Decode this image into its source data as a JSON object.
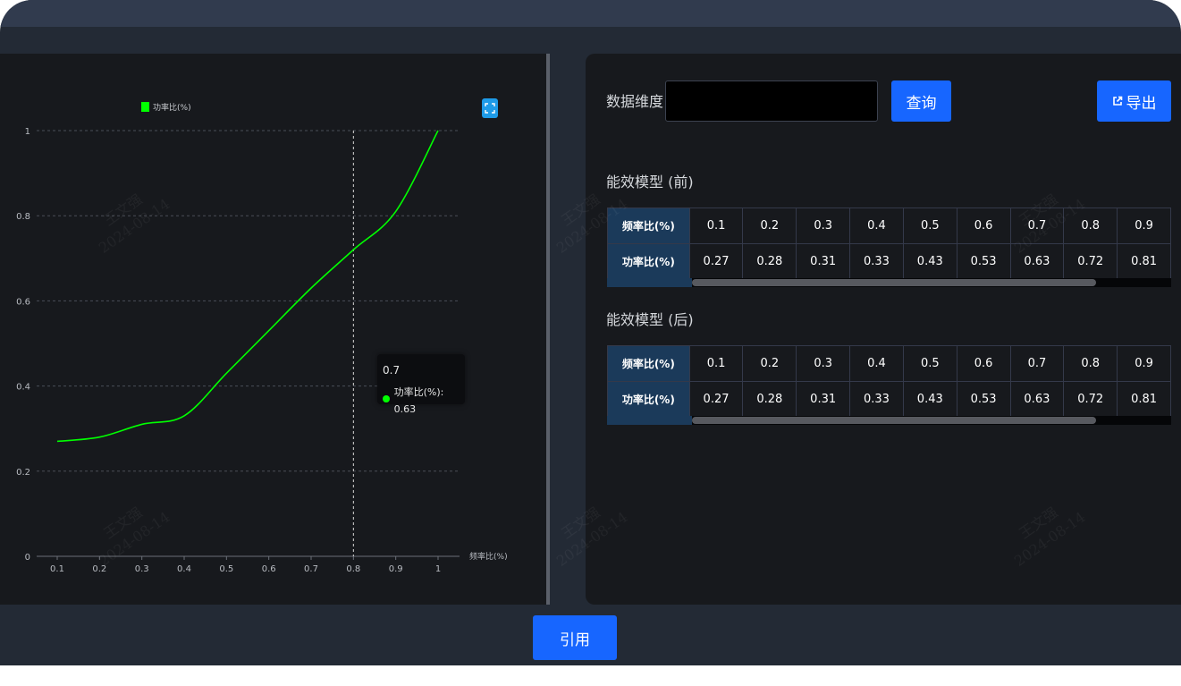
{
  "chart_data": {
    "type": "line",
    "title": "",
    "xlabel": "频率比(%)",
    "ylabel": "",
    "x": [
      0.1,
      0.2,
      0.3,
      0.4,
      0.5,
      0.6,
      0.7,
      0.8,
      0.9,
      1.0
    ],
    "xticks": [
      "0.1",
      "0.2",
      "0.3",
      "0.4",
      "0.5",
      "0.6",
      "0.7",
      "0.8",
      "0.9",
      "1"
    ],
    "yticks": [
      "0",
      "0.2",
      "0.4",
      "0.6",
      "0.8",
      "1"
    ],
    "ylim": [
      0,
      1
    ],
    "grid": true,
    "legend_position": "top-left",
    "series": [
      {
        "name": "功率比(%)",
        "color": "#00ff00",
        "values": [
          0.27,
          0.28,
          0.31,
          0.33,
          0.43,
          0.53,
          0.63,
          0.72,
          0.81,
          1.0
        ]
      }
    ],
    "tooltip": {
      "x": "0.7",
      "series": "功率比(%)",
      "value": "0.63"
    },
    "crosshair_x": 0.8
  },
  "toolbar": {
    "dimension_label": "数据维度",
    "dimension_value": "",
    "query_label": "查询",
    "export_label": "导出",
    "export_icon": "external-link-icon"
  },
  "model_before": {
    "title": "能效模型 (前)",
    "row_headers": [
      "频率比(%)",
      "功率比(%)"
    ],
    "freq": [
      "0.1",
      "0.2",
      "0.3",
      "0.4",
      "0.5",
      "0.6",
      "0.7",
      "0.8",
      "0.9"
    ],
    "power": [
      "0.27",
      "0.28",
      "0.31",
      "0.33",
      "0.43",
      "0.53",
      "0.63",
      "0.72",
      "0.81"
    ]
  },
  "model_after": {
    "title": "能效模型 (后)",
    "row_headers": [
      "频率比(%)",
      "功率比(%)"
    ],
    "freq": [
      "0.1",
      "0.2",
      "0.3",
      "0.4",
      "0.5",
      "0.6",
      "0.7",
      "0.8",
      "0.9"
    ],
    "power": [
      "0.27",
      "0.28",
      "0.31",
      "0.33",
      "0.43",
      "0.53",
      "0.63",
      "0.72",
      "0.81"
    ]
  },
  "footer": {
    "apply_label": "引用"
  },
  "watermark": {
    "name": "王文强",
    "date": "2024-08-14"
  },
  "colors": {
    "accent": "#1766ff",
    "series": "#00ff00",
    "header_cell": "#1b3a5a",
    "panel": "#17191d"
  }
}
